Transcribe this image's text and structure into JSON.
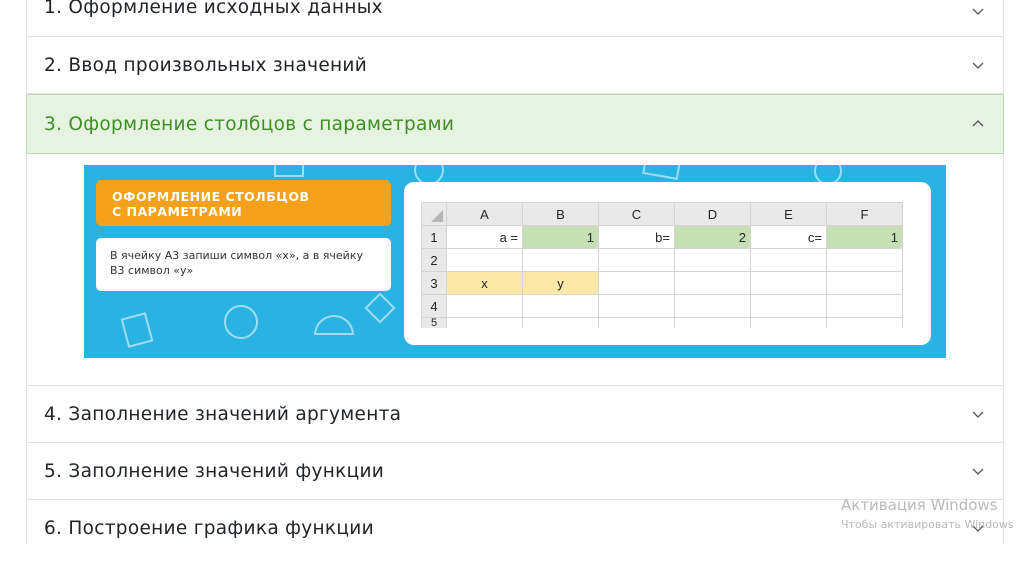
{
  "accordion": {
    "items": [
      {
        "label": "1. Оформление исходных данных",
        "expanded": false
      },
      {
        "label": "2. Ввод произвольных значений",
        "expanded": false
      },
      {
        "label": "3. Оформление столбцов с параметрами",
        "expanded": true
      },
      {
        "label": "4. Заполнение значений аргумента",
        "expanded": false
      },
      {
        "label": "5. Заполнение значений функции",
        "expanded": false
      },
      {
        "label": "6. Построение графика функции",
        "expanded": false
      }
    ],
    "chevron_down_icon": "chevron-down-icon",
    "chevron_up_icon": "chevron-up-icon"
  },
  "banner": {
    "heading": "Оформление столбцов с параметрами",
    "instruction": "В ячейку А3 запиши символ «х», а в ячейку В3 символ «у»",
    "colors": {
      "background": "#2ab2e2",
      "heading_bg": "#f5a11b",
      "param_cell": "#c6e0b4",
      "xy_cell": "#fde9a7"
    },
    "sheet": {
      "columns": [
        "A",
        "B",
        "C",
        "D",
        "E",
        "F"
      ],
      "rows": [
        {
          "n": "1",
          "cells": [
            "a =",
            "1",
            "b=",
            "2",
            "c=",
            "1"
          ]
        },
        {
          "n": "2",
          "cells": [
            "",
            "",
            "",
            "",
            "",
            ""
          ]
        },
        {
          "n": "3",
          "cells": [
            "x",
            "y",
            "",
            "",
            "",
            ""
          ]
        },
        {
          "n": "4",
          "cells": [
            "",
            "",
            "",
            "",
            "",
            ""
          ]
        },
        {
          "n": "5",
          "cells": [
            "",
            "",
            "",
            "",
            "",
            ""
          ]
        }
      ]
    }
  },
  "watermark": {
    "line1": "Активация Windows",
    "line2": "Чтобы активировать Windows"
  },
  "colors": {
    "accent_green": "#3d8f25",
    "active_header_bg": "#e5f3e0"
  }
}
